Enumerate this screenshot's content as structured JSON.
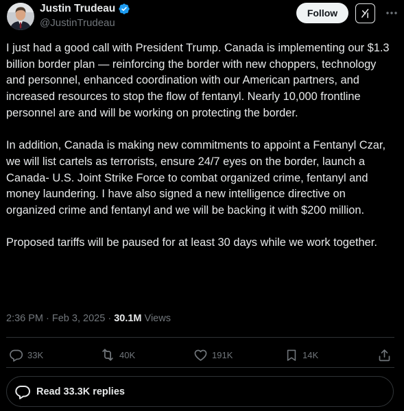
{
  "author": {
    "display_name": "Justin Trudeau",
    "handle": "@JustinTrudeau",
    "verified": true,
    "verified_color": "#1d9bf0"
  },
  "header": {
    "follow_label": "Follow",
    "grok_icon": "grok-icon",
    "more_icon": "more-options-icon"
  },
  "tweet": {
    "paragraphs": [
      "I just had a good call with President Trump. Canada is implementing our $1.3 billion border plan — reinforcing the border with new choppers, technology and personnel, enhanced coordination with our American partners, and increased resources to stop the flow of fentanyl. Nearly 10,000 frontline personnel are and will be working on protecting the border.",
      "In addition, Canada is making new commitments to appoint a Fentanyl Czar, we will list cartels as terrorists, ensure 24/7 eyes on the border, launch a Canada- U.S. Joint Strike Force to combat organized crime, fentanyl and money laundering. I have also signed a new intelligence directive on organized crime and fentanyl and we will be backing it with $200 million.",
      "Proposed tariffs will be paused for at least 30 days while we work together."
    ]
  },
  "meta": {
    "time": "2:36 PM",
    "separator": " · ",
    "date": "Feb 3, 2025",
    "views_count": "30.1M",
    "views_label": " Views"
  },
  "actions": {
    "replies": "33K",
    "reposts": "40K",
    "likes": "191K",
    "bookmarks": "14K"
  },
  "replies_bar": {
    "label": "Read 33.3K replies"
  },
  "colors": {
    "background": "#000000",
    "text": "#e7e9ea",
    "secondary_text": "#71767b",
    "border": "#2f3336",
    "follow_bg": "#eff3f4"
  }
}
